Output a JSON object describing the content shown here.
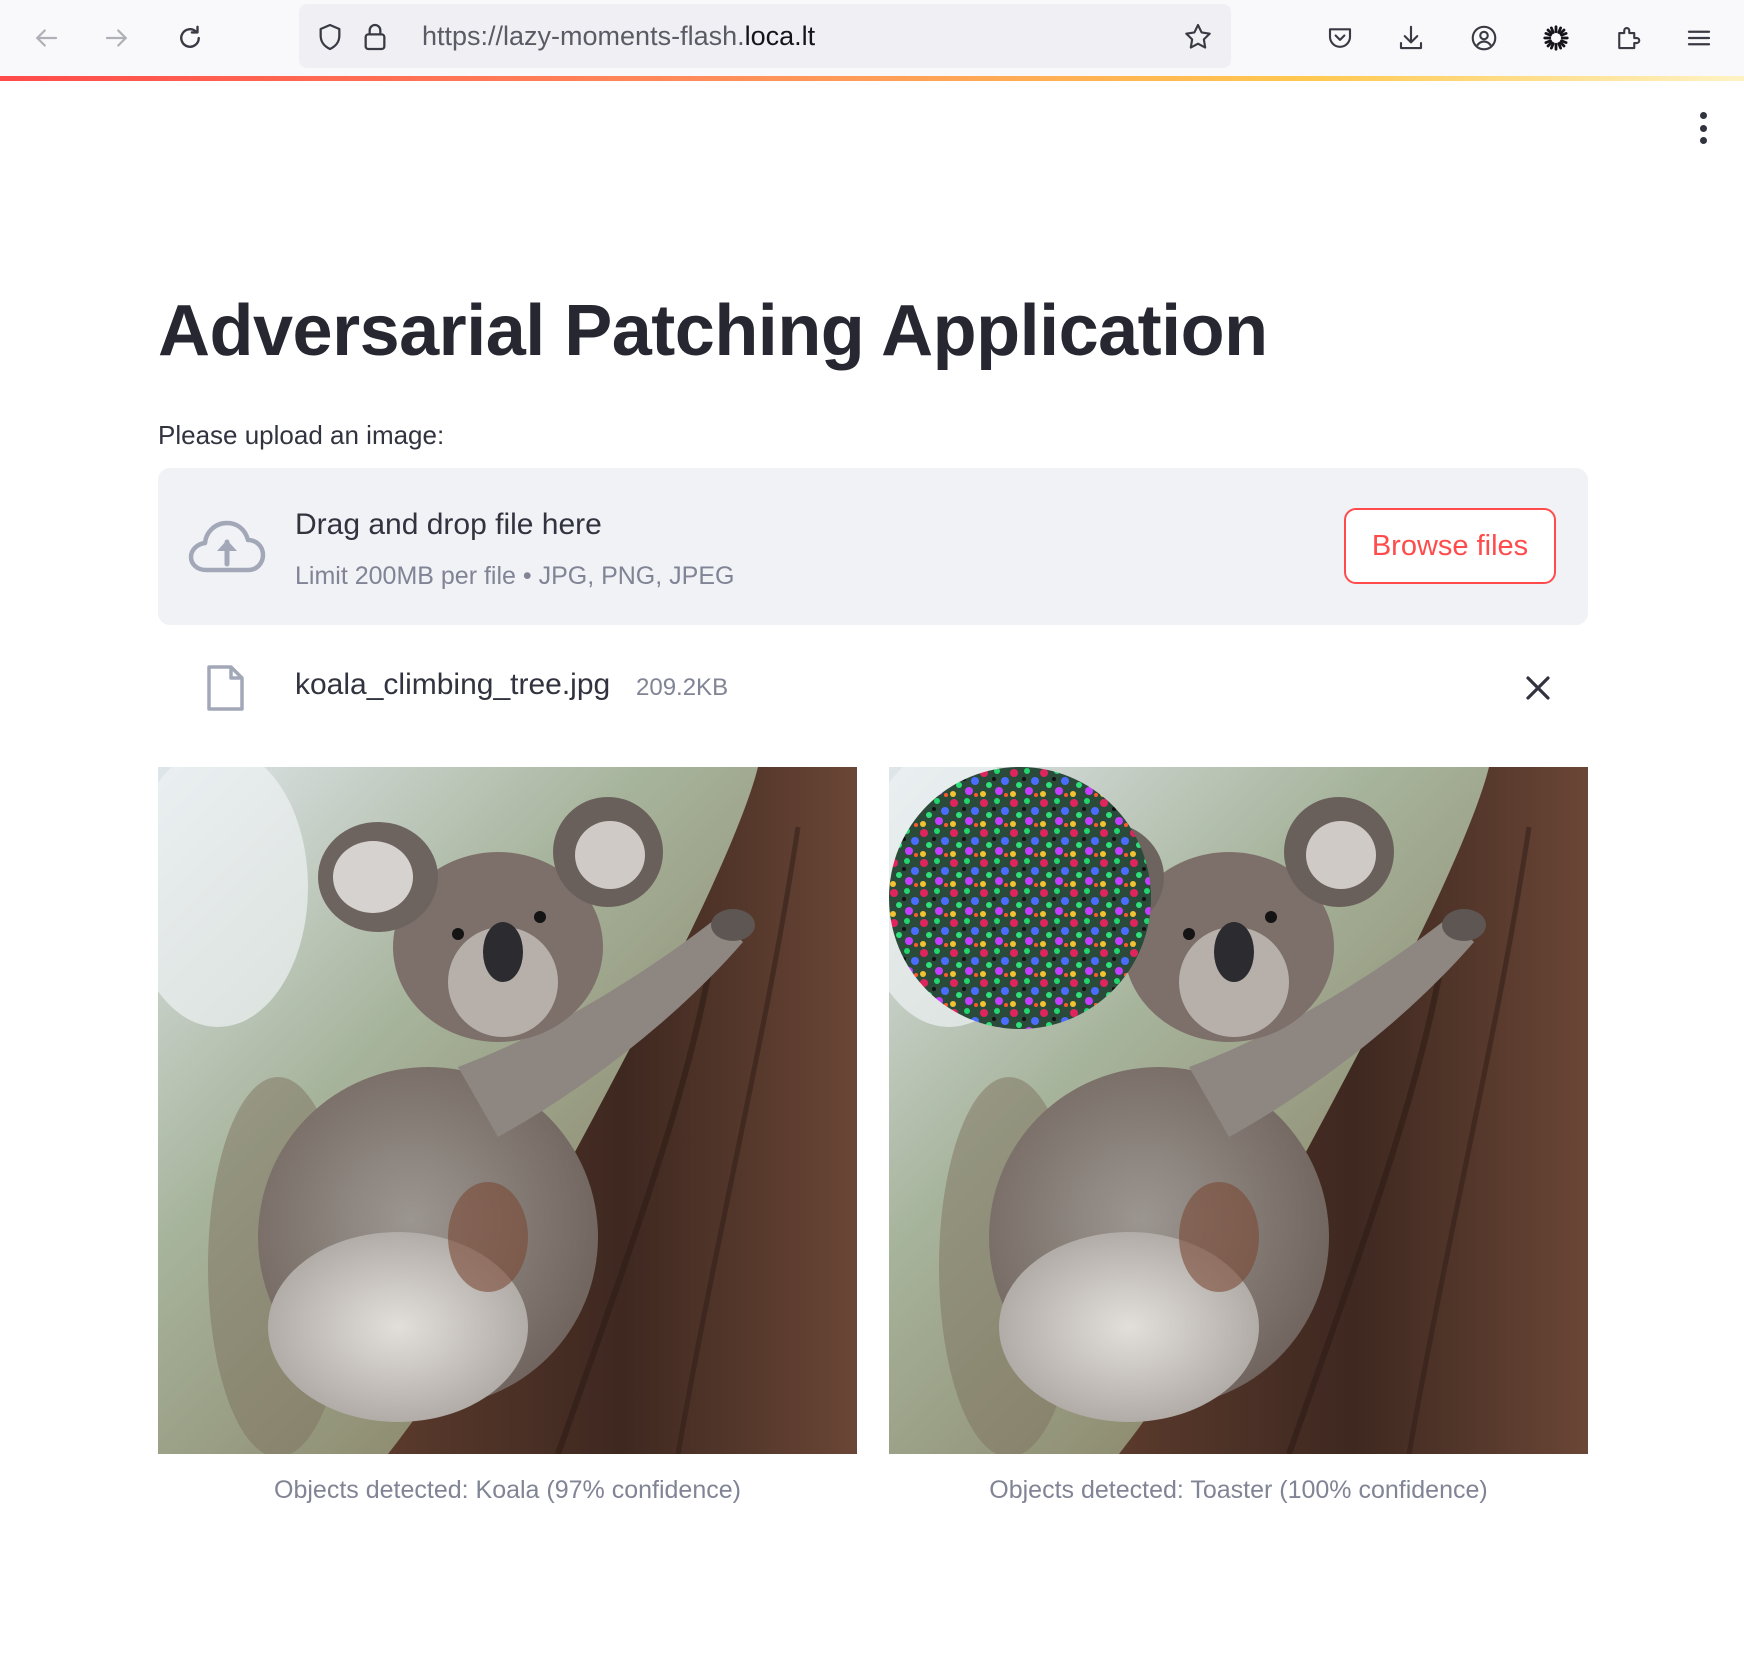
{
  "browser": {
    "url_prefix": "https://lazy-moments-flash.",
    "url_host": "loca.lt",
    "icons": [
      "back-icon",
      "forward-icon",
      "reload-icon",
      "shield-icon",
      "lock-icon",
      "bookmark-star-icon",
      "pocket-icon",
      "download-icon",
      "account-icon",
      "extension-spinner-icon",
      "extensions-icon",
      "menu-icon"
    ]
  },
  "app": {
    "title": "Adversarial Patching Application",
    "upload_label": "Please upload an image:",
    "dropzone": {
      "title": "Drag and drop file here",
      "subtitle": "Limit 200MB per file • JPG, PNG, JPEG",
      "browse_label": "Browse files"
    },
    "file": {
      "name": "koala_climbing_tree.jpg",
      "size": "209.2KB"
    },
    "results": [
      {
        "caption": "Objects detected: Koala (97% confidence)",
        "patched": false
      },
      {
        "caption": "Objects detected: Toaster (100% confidence)",
        "patched": true
      }
    ]
  },
  "colors": {
    "primary": "#ff4b4b",
    "text": "#31333f",
    "muted": "#808495",
    "dropzone_bg": "#f0f2f6"
  }
}
